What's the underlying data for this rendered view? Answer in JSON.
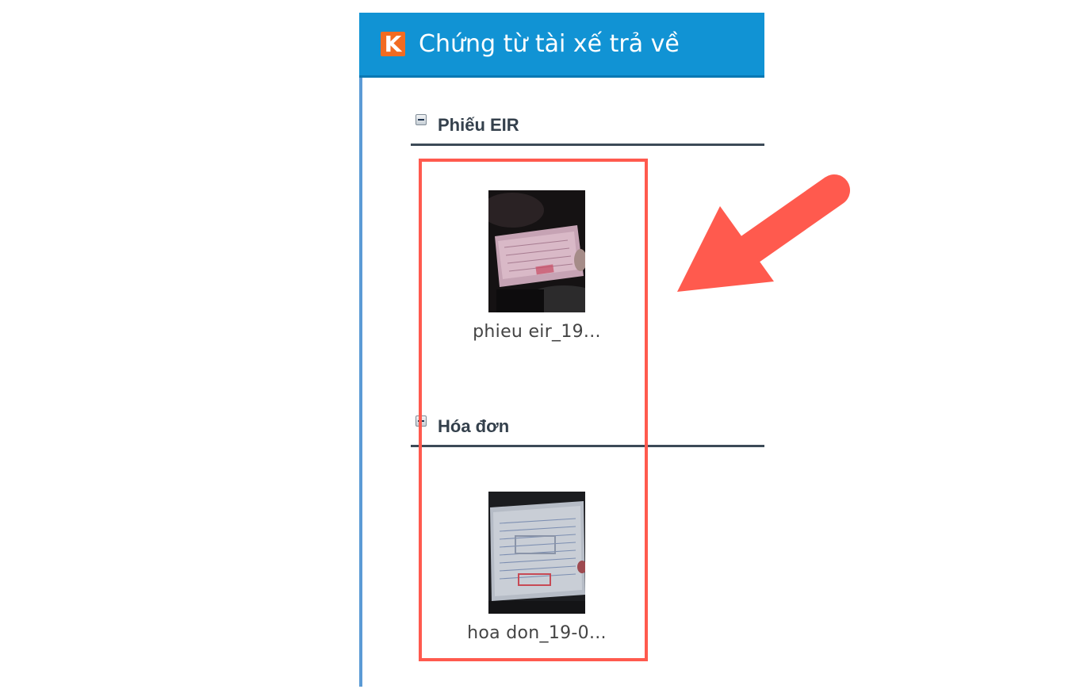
{
  "window": {
    "title": "Chứng từ tài xế trả về",
    "logo_letter": "K"
  },
  "sections": [
    {
      "label": "Phiếu EIR",
      "files": [
        {
          "name": "phieu eir_19...",
          "icon": "photo-thumbnail"
        }
      ]
    },
    {
      "label": "Hóa đơn",
      "files": [
        {
          "name": "hoa don_19-0...",
          "icon": "photo-thumbnail"
        }
      ]
    }
  ],
  "colors": {
    "titlebar": "#1193d4",
    "logo": "#f26b21",
    "annotation": "#ff5a4e",
    "section_rule": "#3c4a57"
  }
}
